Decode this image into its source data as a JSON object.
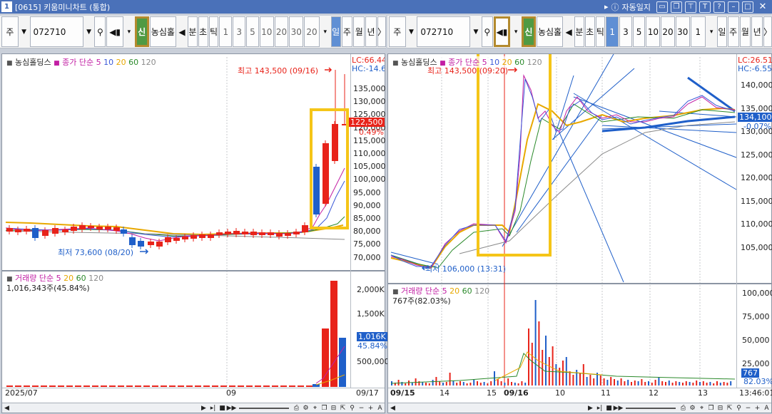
{
  "titlebar": {
    "num": "1",
    "title": "[0615] 키움미니차트 (통합)",
    "auto_label": "자동일지"
  },
  "left": {
    "toolbar": {
      "type": "주",
      "code": "072710",
      "shin": "신",
      "name": "농심홀",
      "periods": [
        "분",
        "초",
        "틱"
      ],
      "nums": [
        "1",
        "3",
        "5",
        "10",
        "20",
        "30"
      ],
      "count": "20",
      "day": "일",
      "week": "주",
      "month": "월",
      "year": "년",
      "arrow": "〉"
    },
    "price_legend": {
      "name": "농심홀딩스",
      "type": "종가",
      "ma_label": "단순",
      "ma": [
        "5",
        "10",
        "20",
        "60",
        "120"
      ]
    },
    "lc": "LC:66.44",
    "hc": "HC:-14.6",
    "high": "최고 143,500 (09/16)",
    "low": "최저 73,600 (08/20)",
    "price_ticks": [
      "135,000",
      "130,000",
      "125,000",
      "120,000",
      "115,000",
      "110,000",
      "105,000",
      "100,000",
      "95,000",
      "90,000",
      "85,000",
      "80,000",
      "75,000",
      "70,000"
    ],
    "last_price": "122,500",
    "last_pct": "0.49%",
    "vol_legend": {
      "name": "거래량",
      "ma_label": "단순",
      "ma": [
        "5",
        "20",
        "60",
        "120"
      ],
      "value": "1,016,343주(45.84%)"
    },
    "vol_ticks": [
      "2,000K",
      "1,500K",
      "1,000K",
      "500,000"
    ],
    "vol_tag": "1,016K",
    "vol_pct": "45.84%",
    "x_labels": [
      "2025/07",
      "09",
      "09/17"
    ]
  },
  "right": {
    "toolbar": {
      "type": "주",
      "code": "072710",
      "shin": "신",
      "name": "농심홀",
      "periods": [
        "분",
        "초",
        "틱"
      ],
      "nums": [
        "1",
        "3",
        "5",
        "10",
        "20",
        "30"
      ],
      "count": "1",
      "day": "일",
      "week": "주",
      "month": "월",
      "year": "년",
      "arrow": "〉"
    },
    "price_legend": {
      "name": "농심홀딩스",
      "type": "종가",
      "ma_label": "단순",
      "ma": [
        "5",
        "10",
        "20",
        "60",
        "120"
      ]
    },
    "lc": "LC:26.51",
    "hc": "HC:-6.55",
    "high": "최고 143,500 (09:20)",
    "low": "최저 106,000 (13:31)",
    "price_ticks": [
      "140,000",
      "135,000",
      "130,000",
      "125,000",
      "120,000",
      "115,000",
      "110,000",
      "105,000"
    ],
    "last_price": "134,100",
    "last_pct": "-0.07%",
    "vol_legend": {
      "name": "거래량",
      "ma_label": "단순",
      "ma": [
        "5",
        "20",
        "60",
        "120"
      ],
      "value": "767주(82.03%)"
    },
    "vol_ticks": [
      "100,000",
      "75,000",
      "50,000",
      "25,000"
    ],
    "vol_tag": "767",
    "vol_pct": "82.03%",
    "x_labels": [
      "09/15",
      "14",
      "15",
      "09/16",
      "10",
      "11",
      "12",
      "13",
      "13:46:01"
    ]
  },
  "colors": {
    "up": "#e8231a",
    "down": "#1f5fc9",
    "ma5": "#c21fa4",
    "ma10": "#3a59d8",
    "ma20": "#e8a800",
    "ma60": "#2b8a2b",
    "ma120": "#8a8a8a",
    "highlight": "#f5c518"
  }
}
